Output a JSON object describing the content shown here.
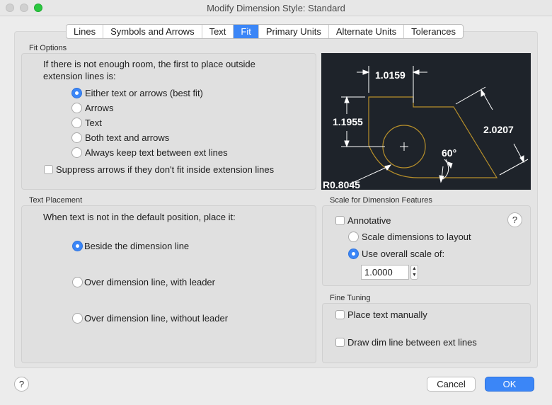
{
  "window": {
    "title": "Modify Dimension Style: Standard"
  },
  "tabs": [
    {
      "label": "Lines"
    },
    {
      "label": "Symbols and Arrows"
    },
    {
      "label": "Text"
    },
    {
      "label": "Fit",
      "active": true
    },
    {
      "label": "Primary Units"
    },
    {
      "label": "Alternate Units"
    },
    {
      "label": "Tolerances"
    }
  ],
  "fit_options": {
    "title": "Fit Options",
    "prompt_line1": "If there is not enough room, the first to place outside",
    "prompt_line2": "extension lines is:",
    "options": [
      {
        "label": "Either text or arrows (best fit)",
        "checked": true
      },
      {
        "label": "Arrows",
        "checked": false
      },
      {
        "label": "Text",
        "checked": false
      },
      {
        "label": "Both text and arrows",
        "checked": false
      },
      {
        "label": "Always keep text between ext lines",
        "checked": false
      }
    ],
    "suppress_label": "Suppress arrows if they don't fit inside extension lines",
    "suppress_checked": false
  },
  "preview": {
    "dim_top": "1.0159",
    "dim_left": "1.1955",
    "dim_right": "2.0207",
    "angle": "60°",
    "radius": "R0.8045",
    "colors": {
      "background": "#1e232a",
      "geometry": "#b8902a",
      "dimension": "#ffffff"
    }
  },
  "text_placement": {
    "title": "Text Placement",
    "prompt": "When text is not in the default position, place it:",
    "options": [
      {
        "label": "Beside the dimension line",
        "checked": true
      },
      {
        "label": "Over dimension line, with leader",
        "checked": false
      },
      {
        "label": "Over dimension line, without leader",
        "checked": false
      }
    ]
  },
  "scale": {
    "title": "Scale for Dimension Features",
    "annotative_label": "Annotative",
    "annotative_checked": false,
    "help": "?",
    "options": [
      {
        "label": "Scale dimensions to layout",
        "checked": false
      },
      {
        "label": "Use overall scale of:",
        "checked": true
      }
    ],
    "overall_scale": "1.0000"
  },
  "fine_tuning": {
    "title": "Fine Tuning",
    "place_manually_label": "Place text manually",
    "draw_dim_line_label": "Draw dim line between ext lines"
  },
  "footer": {
    "help": "?",
    "cancel_label": "Cancel",
    "ok_label": "OK"
  },
  "colors": {
    "accent": "#3b86f7"
  }
}
